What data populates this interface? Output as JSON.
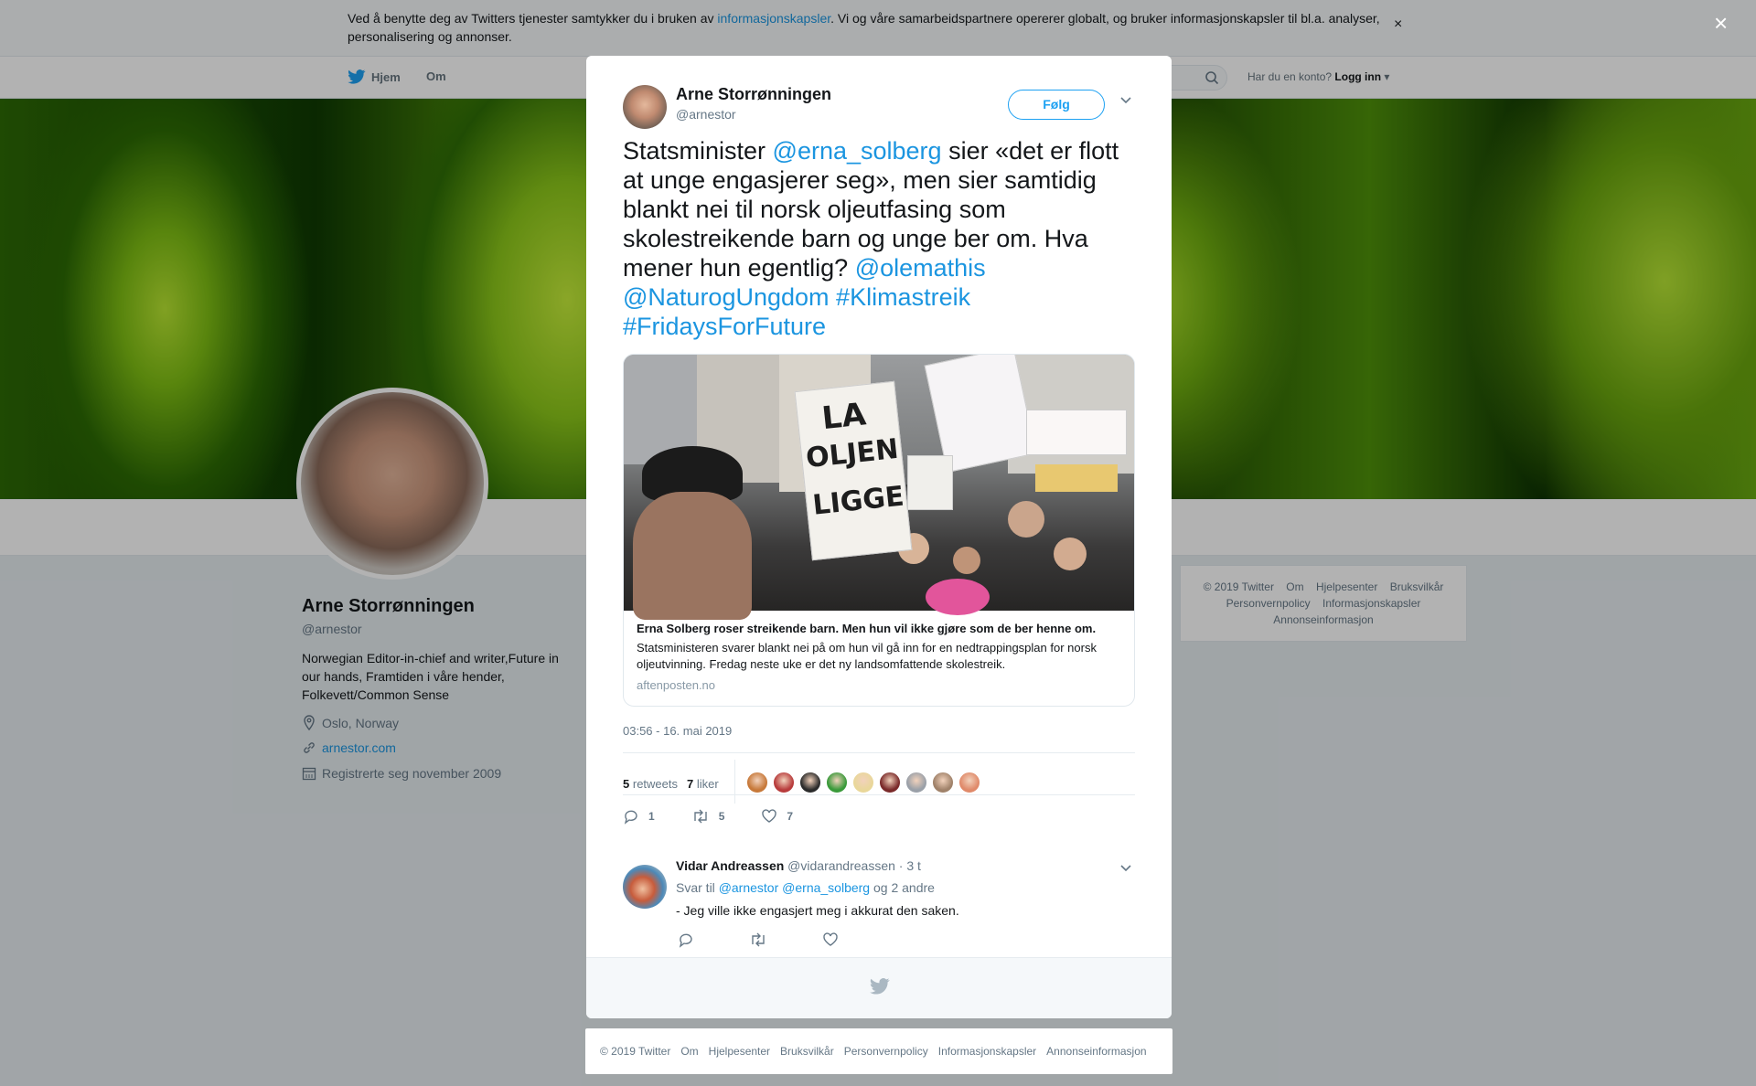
{
  "cookie_banner": {
    "text_before": "Ved å benytte deg av Twitters tjenester samtykker du i bruken av ",
    "link": "informasjonskapsler",
    "text_after": ". Vi og våre samarbeidspartnere opererer globalt, og bruker informasjonskapsler til bl.a. analyser, personalisering og annonser.",
    "close": "×"
  },
  "nav": {
    "home": "Hjem",
    "about": "Om",
    "login_prompt": "Har du en konto?",
    "login": "Logg inn"
  },
  "profile": {
    "name": "Arne Storrønningen",
    "handle": "@arnestor",
    "bio": "Norwegian Editor-in-chief and writer,Future in our hands, Framtiden i våre hender, Folkevett/Common Sense",
    "location": "Oslo, Norway",
    "website": "arnestor.com",
    "joined": "Registrerte seg november 2009"
  },
  "side_footer": {
    "row1": [
      "© 2019 Twitter",
      "Om",
      "Hjelpesenter",
      "Bruksvilkår"
    ],
    "row2": [
      "Personvernpolicy",
      "Informasjonskapsler"
    ],
    "row3": [
      "Annonseinformasjon"
    ]
  },
  "overlay": {
    "close": "×"
  },
  "tweet": {
    "name": "Arne Storrønningen",
    "handle": "@arnestor",
    "follow": "Følg",
    "text_1": "Statsminister ",
    "mention_1": "@erna_solberg",
    "text_2": " sier «det er flott at unge engasjerer seg», men sier samtidig blankt nei til norsk oljeutfasing som skolestreikende barn og unge ber om. Hva mener hun egentlig? ",
    "mention_2": "@olemathis",
    "mention_3": "@NaturogUngdom",
    "hashtag_1": "#Klimastreik",
    "hashtag_2": "#FridaysForFuture",
    "card": {
      "image_sign_text_1": "LA",
      "image_sign_text_2": "OLJEN",
      "image_sign_text_3": "LIGGE!",
      "title": "Erna Solberg roser streikende barn. Men hun vil ikke gjøre som de ber henne om.",
      "description": "Statsministeren svarer blankt nei på om hun vil gå inn for en nedtrappingsplan for norsk oljeutvinning. Fredag neste uke er det ny landsomfattende skolestreik.",
      "domain": "aftenposten.no"
    },
    "timestamp": "03:56 - 16. mai 2019",
    "retweets_count": "5",
    "retweets_label": "retweets",
    "likes_count": "7",
    "likes_label": "liker",
    "likers": [
      "#c7793a",
      "#b83c3c",
      "#2b2b2b",
      "#3a9a3a",
      "#e9d79a",
      "#7a2a2a",
      "#9aa0a8",
      "#a0826a",
      "#e08a6a"
    ],
    "reply_count": "1",
    "retweet_count": "5",
    "like_count": "7"
  },
  "reply": {
    "name": "Vidar Andreassen",
    "handle": "@vidarandreassen",
    "time": "· 3 t",
    "reply_to_label": "Svar til",
    "reply_to_1": "@arnestor",
    "reply_to_2": "@erna_solberg",
    "reply_to_rest": "og 2 andre",
    "text": "- Jeg ville ikke engasjert meg i akkurat den saken."
  },
  "bottom_footer": [
    "© 2019 Twitter",
    "Om",
    "Hjelpesenter",
    "Bruksvilkår",
    "Personvernpolicy",
    "Informasjonskapsler",
    "Annonseinformasjon"
  ],
  "colors": {
    "accent": "#1da1f2",
    "link": "#1b95e0",
    "muted": "#657786"
  }
}
